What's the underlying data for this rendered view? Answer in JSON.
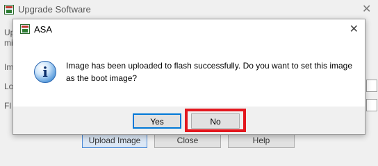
{
  "background_window": {
    "title": "Upgrade Software",
    "close_glyph": "✕",
    "left_fragments": [
      "Up",
      "mi",
      "Im",
      "Lo",
      "Fl"
    ],
    "buttons": {
      "upload": "Upload Image",
      "close": "Close",
      "help": "Help"
    }
  },
  "dialog": {
    "title": "ASA",
    "close_glyph": "✕",
    "icon": "info-icon",
    "icon_glyph": "i",
    "message": "Image has been uploaded to flash successfully. Do you want to set this image as the boot image?",
    "buttons": {
      "yes": "Yes",
      "no": "No"
    }
  },
  "colors": {
    "highlight": "#e3171e",
    "default_button_border": "#0078d7"
  }
}
